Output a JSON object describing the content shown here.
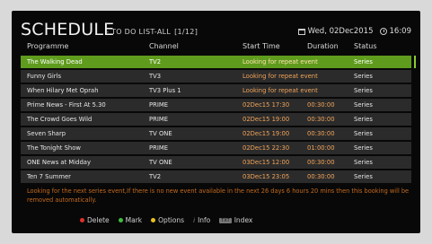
{
  "header": {
    "title": "SCHEDULE",
    "subtitle": "- TO DO LIST-ALL",
    "page_indicator": "[1/12]",
    "date": "Wed, 02Dec2015",
    "time": "16:09"
  },
  "columns": {
    "programme": "Programme",
    "channel": "Channel",
    "start_time": "Start Time",
    "duration": "Duration",
    "status": "Status"
  },
  "rows": [
    {
      "programme": "The Walking Dead",
      "channel": "TV2",
      "start": "Looking for repeat event",
      "duration": "",
      "status": "Series"
    },
    {
      "programme": "Funny Girls",
      "channel": "TV3",
      "start": "Looking for repeat event",
      "duration": "",
      "status": "Series"
    },
    {
      "programme": "When Hilary Met Oprah",
      "channel": "TV3 Plus 1",
      "start": "Looking for repeat event",
      "duration": "",
      "status": "Series"
    },
    {
      "programme": "Prime News - First At 5.30",
      "channel": "PRIME",
      "start": "02Dec15 17:30",
      "duration": "00:30:00",
      "status": "Series"
    },
    {
      "programme": "The Crowd Goes Wild",
      "channel": "PRIME",
      "start": "02Dec15 19:00",
      "duration": "00:30:00",
      "status": "Series"
    },
    {
      "programme": "Seven Sharp",
      "channel": "TV ONE",
      "start": "02Dec15 19:00",
      "duration": "00:30:00",
      "status": "Series"
    },
    {
      "programme": "The Tonight Show",
      "channel": "PRIME",
      "start": "02Dec15 22:30",
      "duration": "01:00:00",
      "status": "Series"
    },
    {
      "programme": "ONE News at Midday",
      "channel": "TV ONE",
      "start": "03Dec15 12:00",
      "duration": "00:30:00",
      "status": "Series"
    },
    {
      "programme": "Ten 7 Summer",
      "channel": "TV2",
      "start": "03Dec15 23:05",
      "duration": "00:30:00",
      "status": "Series"
    }
  ],
  "note": "Looking for the next series event,If there is no new event available in the next 26 days 6 hours 20 mins then this booking will be removed automatically.",
  "legend": {
    "delete": "Delete",
    "mark": "Mark",
    "options": "Options",
    "info": "Info",
    "index": "Index",
    "index_key": "TXT"
  },
  "colors": {
    "selected_row": "#5f9c1d",
    "row_bg": "#2b2b2b",
    "orange_text": "#f0a35a",
    "red_key": "#e0312b",
    "green_key": "#3fbf3f",
    "yellow_key": "#e8c21c"
  }
}
